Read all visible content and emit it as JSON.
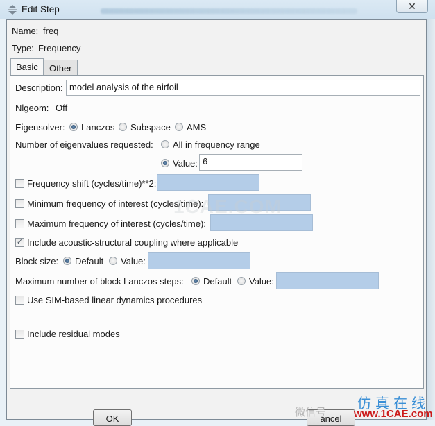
{
  "window": {
    "title": "Edit Step",
    "close_glyph": "✕"
  },
  "step": {
    "name_label": "Name:",
    "name_value": "freq",
    "type_label": "Type:",
    "type_value": "Frequency"
  },
  "tabs": [
    {
      "label": "Basic",
      "active": true
    },
    {
      "label": "Other",
      "active": false
    }
  ],
  "basic": {
    "description_label": "Description:",
    "description_value": "model analysis of the airfoil",
    "nlgeom_label": "Nlgeom:",
    "nlgeom_value": "Off",
    "eigensolver_label": "Eigensolver:",
    "eigensolver_options": [
      "Lanczos",
      "Subspace",
      "AMS"
    ],
    "eigensolver_selected": "Lanczos",
    "num_eigen_label": "Number of eigenvalues requested:",
    "num_eigen_all_label": "All in frequency range",
    "num_eigen_value_label": "Value:",
    "num_eigen_value": "6",
    "freq_shift_label": "Frequency shift (cycles/time)**2:",
    "freq_shift_checked": false,
    "min_freq_label": "Minimum frequency of interest (cycles/time):",
    "min_freq_checked": false,
    "max_freq_label": "Maximum frequency of interest (cycles/time):",
    "max_freq_checked": false,
    "acoustic_label": "Include acoustic-structural coupling where applicable",
    "acoustic_checked": true,
    "block_size_label": "Block size:",
    "block_size_default_label": "Default",
    "block_size_value_label": "Value:",
    "block_size_selected": "Default",
    "lanczos_steps_label": "Maximum number of block Lanczos steps:",
    "lanczos_steps_default_label": "Default",
    "lanczos_steps_value_label": "Value:",
    "lanczos_steps_selected": "Default",
    "sim_label": "Use SIM-based linear dynamics procedures",
    "sim_checked": false,
    "residual_label": "Include residual modes",
    "residual_checked": false
  },
  "buttons": {
    "ok": "OK",
    "cancel": "ancel"
  },
  "watermarks": {
    "center": "1CAE.COM",
    "chinese": "仿真在线",
    "url": "www.1CAE.com",
    "wechat": "微信号"
  },
  "colors": {
    "disabled_field": "#b4cde8",
    "watermark_blue": "#3a8fd6",
    "watermark_red": "#cc1a1a"
  }
}
